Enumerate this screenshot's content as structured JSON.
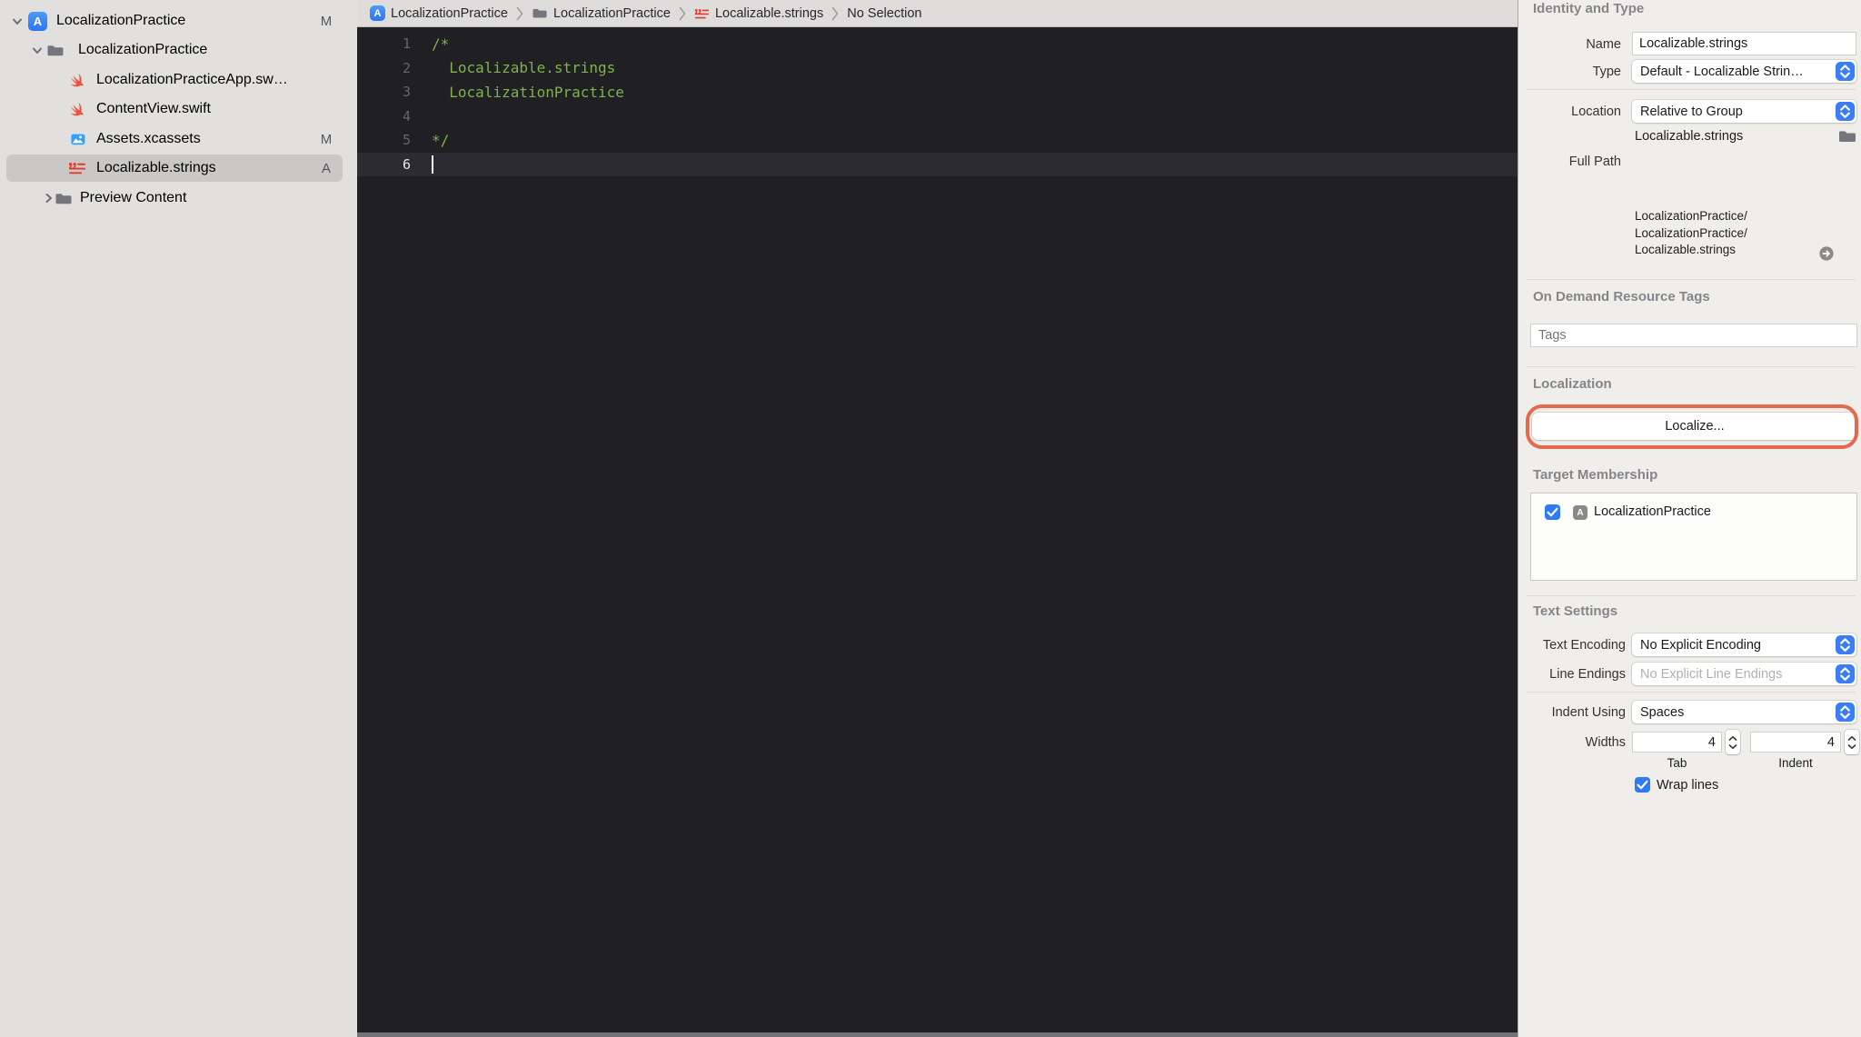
{
  "colors": {
    "editor_bg": "#1f1f24",
    "comment_green": "#7fb347",
    "annotation_red": "#e5694f",
    "stepper_blue": "#3b7cf7",
    "checkbox_blue": "#2f7bf6",
    "strings_icon_red": "#e23b2e",
    "swift_orange": "#f05138",
    "sidebar_bg": "#e1e0de",
    "selection_gray": "#c9c8c6"
  },
  "sidebar": {
    "items": [
      {
        "label": "LocalizationPractice",
        "badge": "M",
        "icon": "app-icon",
        "disclosure": "down",
        "selected": false
      },
      {
        "label": "LocalizationPractice",
        "badge": "",
        "icon": "folder-icon",
        "disclosure": "down",
        "selected": false
      },
      {
        "label": "LocalizationPracticeApp.sw…",
        "badge": "",
        "icon": "swift-icon",
        "disclosure": "",
        "selected": false
      },
      {
        "label": "ContentView.swift",
        "badge": "",
        "icon": "swift-icon",
        "disclosure": "",
        "selected": false
      },
      {
        "label": "Assets.xcassets",
        "badge": "M",
        "icon": "assets-icon",
        "disclosure": "",
        "selected": false
      },
      {
        "label": "Localizable.strings",
        "badge": "A",
        "icon": "strings-icon",
        "disclosure": "",
        "selected": true
      },
      {
        "label": "Preview Content",
        "badge": "",
        "icon": "folder-icon",
        "disclosure": "right",
        "selected": false
      }
    ]
  },
  "jumpbar": {
    "crumbs": [
      {
        "label": "LocalizationPractice",
        "icon": "app-icon"
      },
      {
        "label": "LocalizationPractice",
        "icon": "folder-icon"
      },
      {
        "label": "Localizable.strings",
        "icon": "strings-icon"
      },
      {
        "label": "No Selection",
        "icon": ""
      }
    ]
  },
  "editor": {
    "lines": [
      {
        "num": "1",
        "text": "/*"
      },
      {
        "num": "2",
        "text": "  Localizable.strings"
      },
      {
        "num": "3",
        "text": "  LocalizationPractice"
      },
      {
        "num": "4",
        "text": ""
      },
      {
        "num": "5",
        "text": "*/"
      },
      {
        "num": "6",
        "text": ""
      }
    ],
    "current_line": "6"
  },
  "inspector": {
    "identity": {
      "title": "Identity and Type",
      "name_label": "Name",
      "name_value": "Localizable.strings",
      "type_label": "Type",
      "type_value": "Default - Localizable Strin…",
      "location_label": "Location",
      "location_value": "Relative to Group",
      "location_file": "Localizable.strings",
      "full_path_label": "Full Path",
      "path_lines": [
        "LocalizationPractice/",
        "LocalizationPractice/",
        "Localizable.strings"
      ]
    },
    "odr": {
      "title": "On Demand Resource Tags",
      "tags_placeholder": "Tags"
    },
    "localization": {
      "title": "Localization",
      "localize_button": "Localize..."
    },
    "target_membership": {
      "title": "Target Membership",
      "target_label": "LocalizationPractice"
    },
    "text_settings": {
      "title": "Text Settings",
      "text_encoding_label": "Text Encoding",
      "text_encoding_value": "No Explicit Encoding",
      "line_endings_label": "Line Endings",
      "line_endings_value": "No Explicit Line Endings",
      "indent_using_label": "Indent Using",
      "indent_using_value": "Spaces",
      "widths_label": "Widths",
      "tab_width_value": "4",
      "indent_width_value": "4",
      "tab_label": "Tab",
      "indent_label": "Indent",
      "wrap_lines_label": "Wrap lines"
    }
  }
}
